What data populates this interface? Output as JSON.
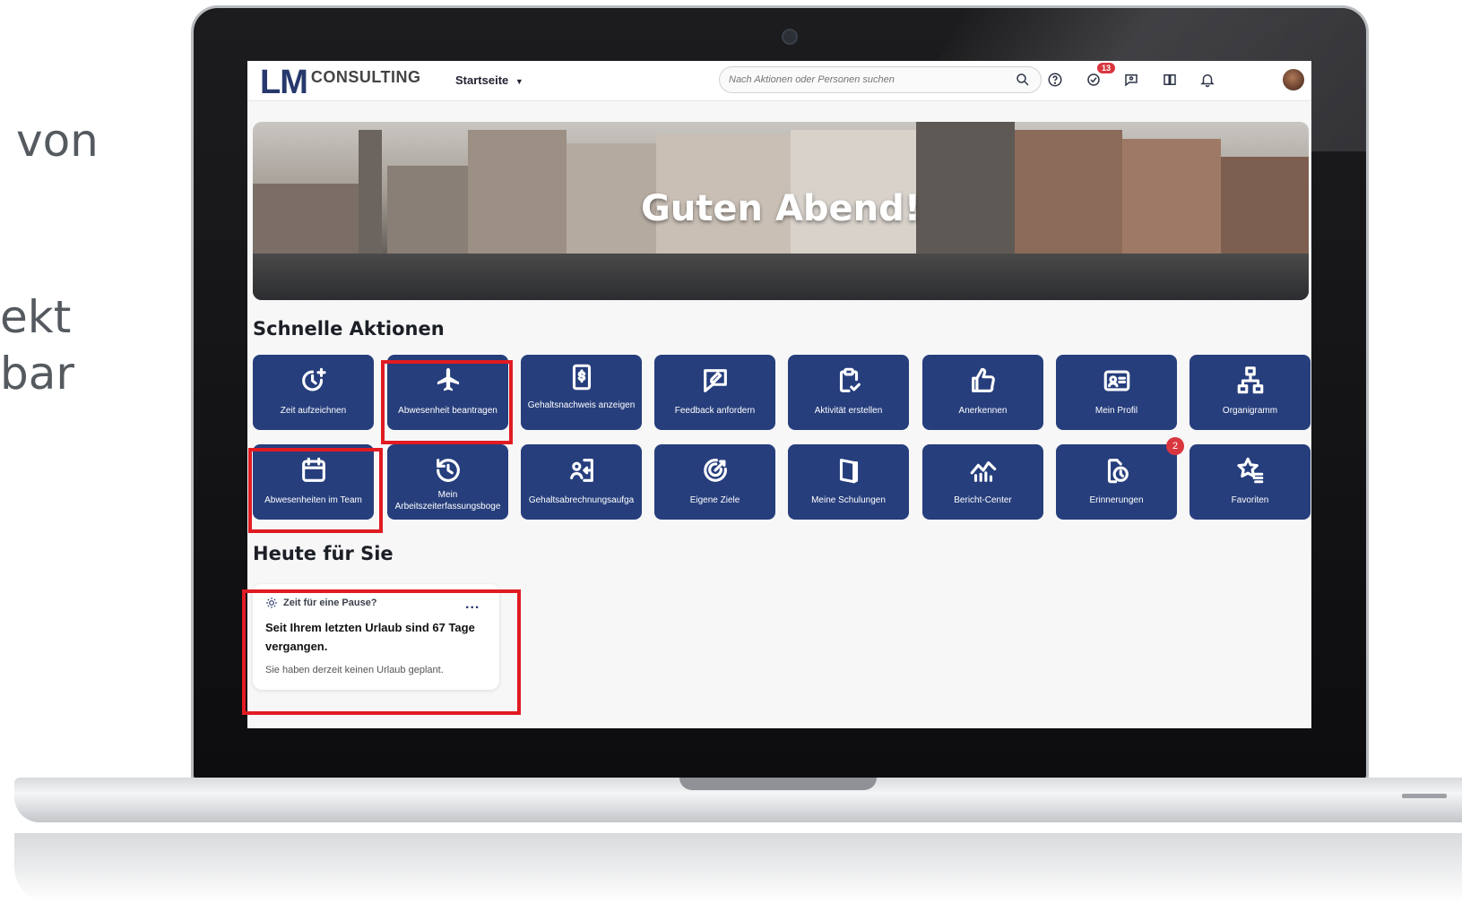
{
  "slide": {
    "text_lines": [
      "von",
      "ekt",
      "bar"
    ]
  },
  "app": {
    "logo_main": "LM",
    "logo_sub": "CONSULTING",
    "nav_home": "Startseite",
    "search_placeholder": "Nach Aktionen oder Personen suchen",
    "notification_count": "13",
    "accent": "#263e7c",
    "highlight_color": "#e11b22"
  },
  "hero": {
    "greeting": "Guten Abend!"
  },
  "quick_actions": {
    "title": "Schnelle Aktionen",
    "tiles": [
      {
        "label": "Zeit aufzeichnen",
        "icon": "clock-plus-icon"
      },
      {
        "label": "Abwesenheit beantragen",
        "icon": "airplane-icon"
      },
      {
        "label": "Gehaltsnachweis anzeigen",
        "icon": "dollar-document-icon"
      },
      {
        "label": "Feedback anfordern",
        "icon": "feedback-icon"
      },
      {
        "label": "Aktivität erstellen",
        "icon": "clipboard-check-icon"
      },
      {
        "label": "Anerkennen",
        "icon": "thumbs-up-icon"
      },
      {
        "label": "Mein Profil",
        "icon": "id-card-icon"
      },
      {
        "label": "Organigramm",
        "icon": "org-chart-icon"
      },
      {
        "label": "Abwesenheiten im Team",
        "icon": "calendar-icon"
      },
      {
        "label": "Mein Arbeitszeiterfassungsboge",
        "icon": "history-icon"
      },
      {
        "label": "Gehaltsabrechnungsaufga",
        "icon": "person-transfer-icon"
      },
      {
        "label": "Eigene Ziele",
        "icon": "target-icon"
      },
      {
        "label": "Meine Schulungen",
        "icon": "book-icon"
      },
      {
        "label": "Bericht-Center",
        "icon": "chart-icon"
      },
      {
        "label": "Erinnerungen",
        "icon": "reminder-icon",
        "badge": "2"
      },
      {
        "label": "Favoriten",
        "icon": "star-list-icon"
      }
    ]
  },
  "today": {
    "title": "Heute für Sie",
    "card": {
      "heading": "Zeit für eine Pause?",
      "message": "Seit Ihrem letzten Urlaub sind 67 Tage vergangen.",
      "subtext": "Sie haben derzeit keinen Urlaub geplant.",
      "menu": "..."
    }
  }
}
